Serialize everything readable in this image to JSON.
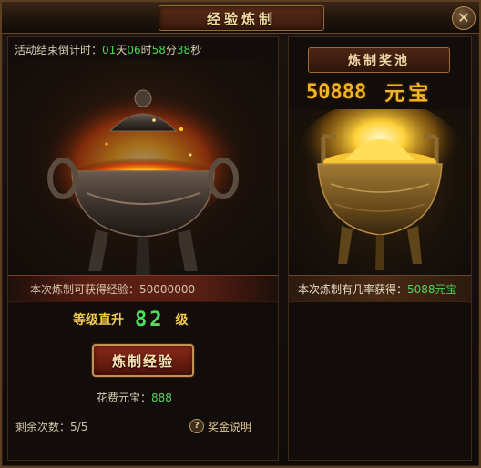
{
  "window": {
    "title": "经验炼制",
    "close_label": "✕"
  },
  "left": {
    "timer_label": "活动结束倒计时：",
    "timer": {
      "days": "01",
      "days_unit": "天",
      "hours": "06",
      "hours_unit": "时",
      "minutes": "58",
      "minutes_unit": "分",
      "seconds": "38",
      "seconds_unit": "秒"
    },
    "exp_label": "本次炼制可获得经验：",
    "exp_value": "50000000",
    "levelup_label": "等级直升",
    "levelup_value": "82",
    "levelup_unit": "级",
    "refine_button": "炼制经验",
    "cost_label": "花费元宝：",
    "cost_value": "888",
    "remain_label": "剩余次数：",
    "remain_value": "5/5",
    "help_icon_glyph": "?",
    "help_link": "奖金说明"
  },
  "right": {
    "pool_label": "炼制奖池",
    "pool_amount": "50888",
    "pool_unit": "元宝",
    "chance_label": "本次炼制有几率获得：",
    "chance_value": "5088元宝"
  },
  "colors": {
    "accent_green": "#52d35a",
    "gold": "#f1b624",
    "title_text": "#f3d8a0"
  }
}
